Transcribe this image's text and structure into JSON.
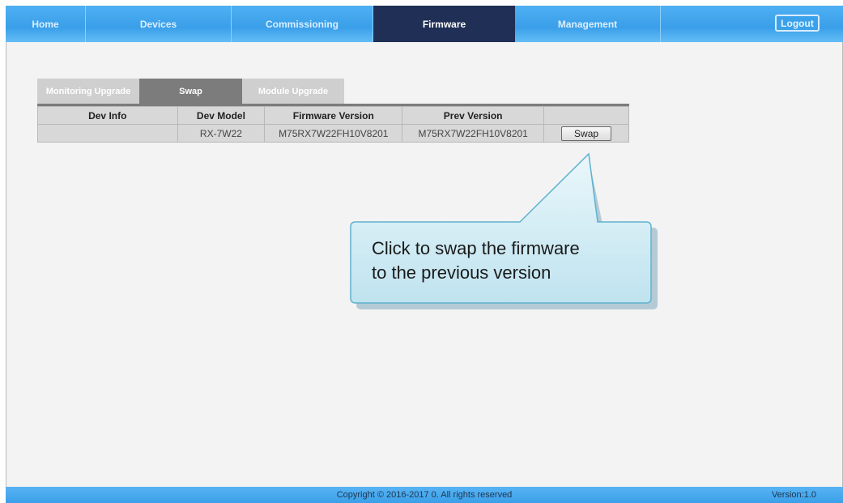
{
  "nav": {
    "home": "Home",
    "devices": "Devices",
    "commissioning": "Commissioning",
    "firmware": "Firmware",
    "management": "Management",
    "logout": "Logout"
  },
  "tabs": {
    "monitoring": "Monitoring Upgrade",
    "swap": "Swap",
    "module": "Module Upgrade"
  },
  "table": {
    "headers": [
      "Dev Info",
      "Dev Model",
      "Firmware Version",
      "Prev Version",
      ""
    ],
    "rows": [
      {
        "dev_info": "",
        "dev_model": "RX-7W22",
        "firmware_version": "M75RX7W22FH10V8201",
        "prev_version": "M75RX7W22FH10V8201",
        "action": "Swap"
      }
    ]
  },
  "callout": {
    "line1": "Click to swap the firmware",
    "line2": "to the previous version"
  },
  "footer": {
    "copyright": "Copyright © 2016-2017 0. All rights reserved",
    "version": "Version:1.0"
  },
  "colors": {
    "nav_active": "#1f2f55",
    "nav_bar": "#3a9fe9",
    "callout_fill": "#cfeaf3",
    "callout_border": "#5fb2cf"
  }
}
